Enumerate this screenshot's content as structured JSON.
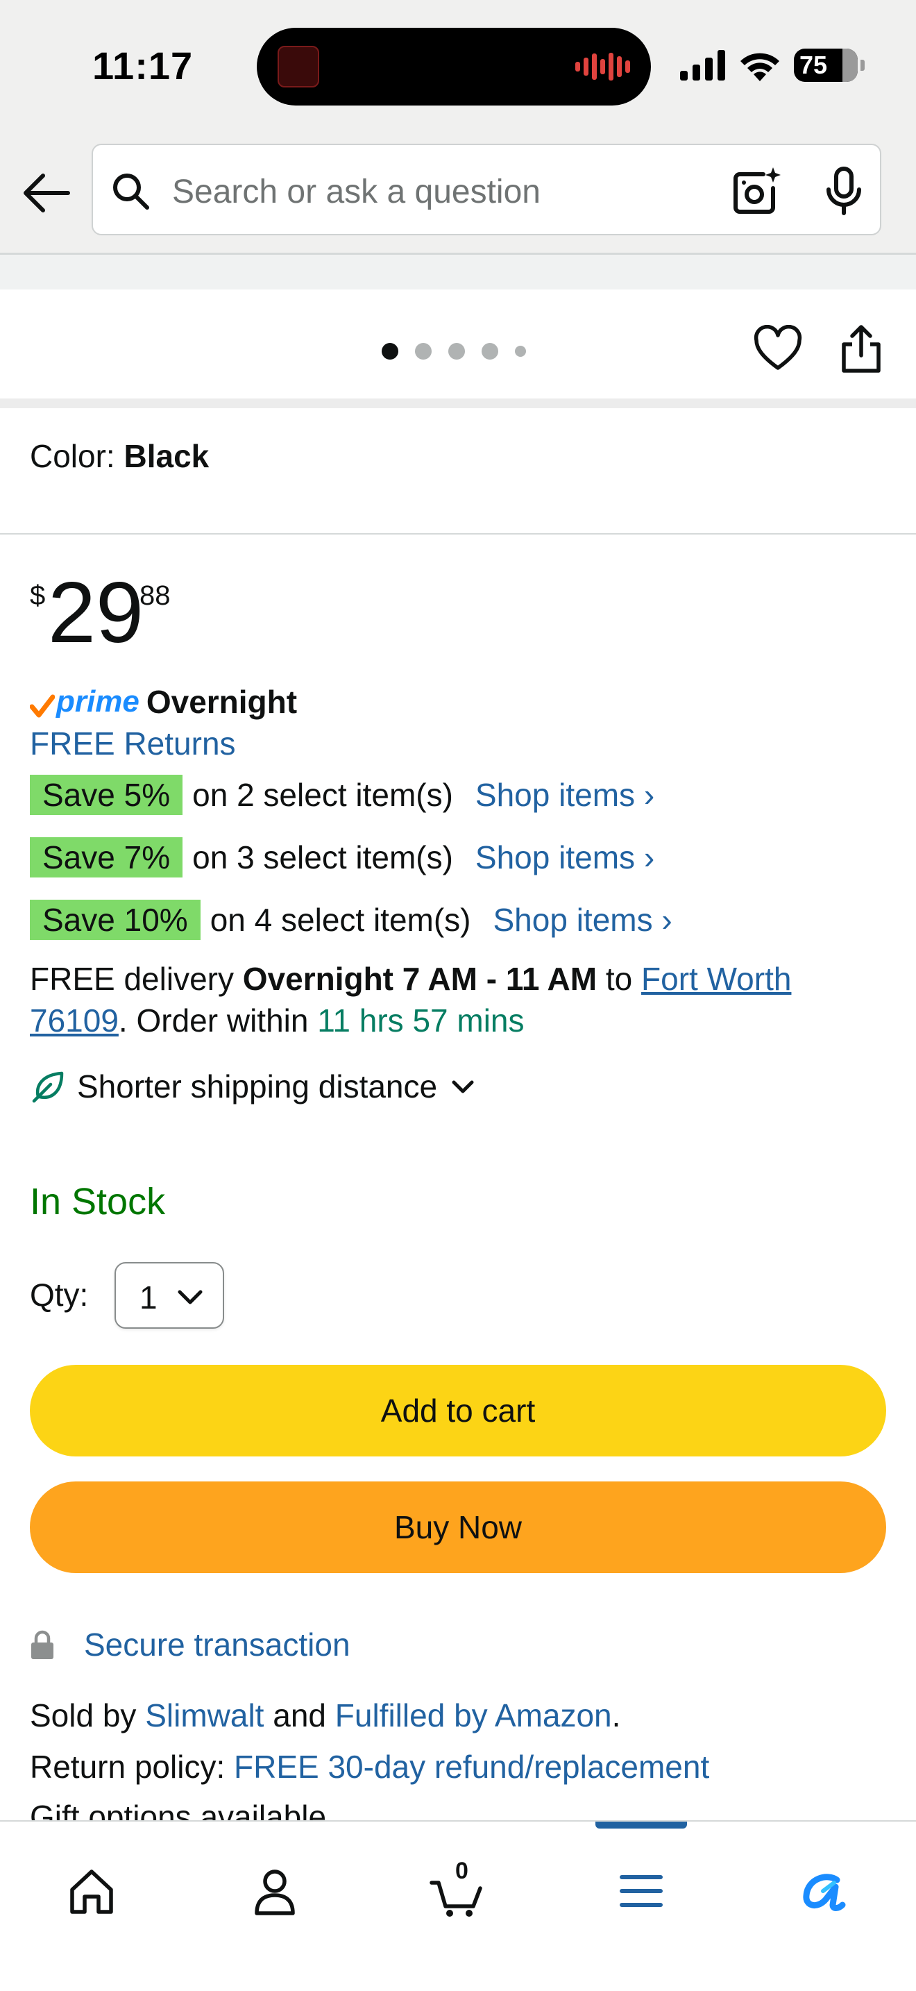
{
  "status_bar": {
    "time": "11:17",
    "battery": "75"
  },
  "search": {
    "placeholder": "Search or ask a question"
  },
  "carousel": {
    "dots": 5,
    "active_index": 0
  },
  "product": {
    "color_label": "Color: ",
    "color_value": "Black",
    "price_symbol": "$",
    "price_whole": "29",
    "price_fraction": "88",
    "prime_label": "prime",
    "prime_speed": "Overnight",
    "free_returns": "FREE Returns"
  },
  "savings": [
    {
      "badge": "Save 5%",
      "text": "on 2 select item(s)",
      "link": "Shop items ›"
    },
    {
      "badge": "Save 7%",
      "text": "on 3 select item(s)",
      "link": "Shop items ›"
    },
    {
      "badge": "Save 10%",
      "text": "on 4 select item(s)",
      "link": "Shop items ›"
    }
  ],
  "delivery": {
    "prefix": "FREE delivery ",
    "window": "Overnight 7 AM - 11 AM",
    "to": " to ",
    "location": "Fort Worth 76109",
    "order_within_prefix": ". Order within ",
    "countdown": "11 hrs 57 mins"
  },
  "shipping_note": "Shorter shipping distance",
  "stock": "In Stock",
  "quantity": {
    "label": "Qty:",
    "value": "1"
  },
  "buttons": {
    "add_to_cart": "Add to cart",
    "buy_now": "Buy Now"
  },
  "secure": "Secure transaction",
  "seller": {
    "sold_by": "Sold by ",
    "seller_name": "Slimwalt",
    "and": " and ",
    "fulfilled": "Fulfilled by Amazon",
    "period": ".",
    "return_label": "Return policy: ",
    "return_policy": "FREE 30-day refund/replacement",
    "gift": "Gift options available"
  },
  "bottom_nav": {
    "cart_count": "0",
    "active": "menu"
  },
  "colors": {
    "link": "#2162a1",
    "save_badge": "#7fda69",
    "in_stock": "#007600",
    "countdown": "#067d62",
    "add_to_cart": "#fcd415",
    "buy_now": "#fea41e",
    "prime_blue": "#1a8cff",
    "prime_check": "#ff7a00"
  }
}
